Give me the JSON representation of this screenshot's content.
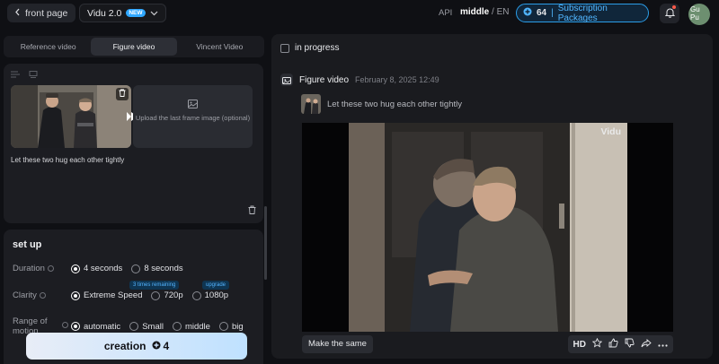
{
  "topbar": {
    "back_label": "front page",
    "model_label": "Vidu 2.0",
    "new_badge": "NEW",
    "api_label": "API",
    "lang_current": "middle",
    "lang_sep": "/",
    "lang_alt": "EN",
    "credits": "64",
    "sub_sep": "|",
    "subscription_label": "Subscription Packages",
    "avatar_text": "Gu Pu"
  },
  "left": {
    "tabs": [
      {
        "label": "Reference video",
        "active": false
      },
      {
        "label": "Figure video",
        "active": true
      },
      {
        "label": "Vincent Video",
        "active": false
      }
    ],
    "upload_label": "Upload the last frame image (optional)",
    "prompt": "Let these two hug each other tightly",
    "setup": {
      "title": "set up",
      "duration": {
        "label": "Duration",
        "options": [
          "4 seconds",
          "8 seconds"
        ],
        "selected": 0
      },
      "clarity": {
        "label": "Clarity",
        "options": [
          "Extreme Speed",
          "720p",
          "1080p"
        ],
        "selected": 0,
        "chip_remaining": "3 times remaining",
        "chip_upgrade": "upgrade"
      },
      "motion": {
        "label": "Range of motion",
        "options": [
          "automatic",
          "Small",
          "middle",
          "big"
        ],
        "selected": 0
      }
    },
    "create_label": "creation",
    "create_cost": "4"
  },
  "right": {
    "in_progress_label": "in progress",
    "task": {
      "title": "Figure video",
      "date": "February 8, 2025 12:49",
      "prompt": "Let these two hug each other tightly"
    },
    "watermark": "Vidu",
    "make_same_label": "Make the same",
    "hd_label": "HD"
  },
  "colors": {
    "accent": "#2b9de8",
    "background": "#0f1014",
    "panel": "#1c1d22"
  }
}
